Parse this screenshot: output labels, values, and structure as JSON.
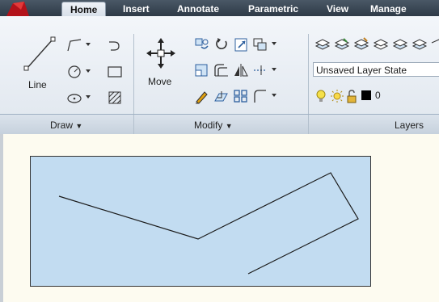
{
  "tabs": [
    {
      "label": "Home",
      "active": true
    },
    {
      "label": "Insert"
    },
    {
      "label": "Annotate"
    },
    {
      "label": "Parametric"
    },
    {
      "label": "View"
    },
    {
      "label": "Manage"
    }
  ],
  "panels": {
    "draw": {
      "title": "Draw",
      "line_label": "Line"
    },
    "modify": {
      "title": "Modify",
      "move_label": "Move"
    },
    "layers": {
      "title": "Layers",
      "layer_state": "Unsaved Layer State",
      "current_layer": "0"
    }
  },
  "colors": {
    "accent": "#c2dcf1",
    "tabbar": "#2e3a47",
    "ribbon": "#e6ecf2"
  },
  "icons": [
    "app-menu-icon",
    "line-icon",
    "polyline-icon",
    "circle-icon",
    "arc-icon",
    "rectangle-icon",
    "ellipse-icon",
    "hatch-icon",
    "move-icon",
    "rotate-icon",
    "copy-icon",
    "stretch-icon",
    "mirror-icon",
    "scale-icon",
    "fillet-icon",
    "array-icon",
    "trim-icon",
    "offset-icon",
    "explode-icon",
    "lightbulb-icon",
    "sun-icon",
    "lock-icon",
    "color-swatch-icon"
  ]
}
